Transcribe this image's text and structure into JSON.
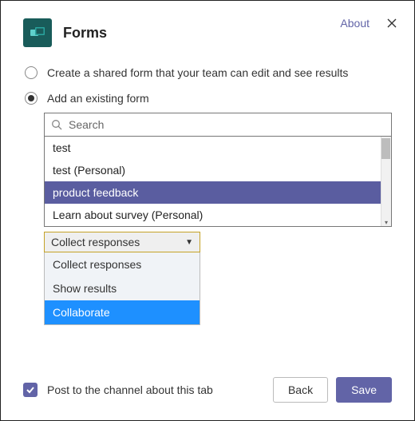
{
  "header": {
    "title": "Forms",
    "about_label": "About"
  },
  "options": {
    "create_label": "Create a shared form that your team can edit and see results",
    "add_existing_label": "Add an existing form",
    "selected": "add_existing"
  },
  "search": {
    "placeholder": "Search",
    "value": "",
    "results": [
      {
        "label": "test",
        "selected": false
      },
      {
        "label": "test (Personal)",
        "selected": false
      },
      {
        "label": "product feedback",
        "selected": true
      },
      {
        "label": "Learn about survey (Personal)",
        "selected": false
      }
    ]
  },
  "mode_select": {
    "value": "Collect responses",
    "options": [
      {
        "label": "Collect responses",
        "highlighted": false
      },
      {
        "label": "Show results",
        "highlighted": false
      },
      {
        "label": "Collaborate",
        "highlighted": true
      }
    ]
  },
  "footer": {
    "post_label": "Post to the channel about this tab",
    "post_checked": true,
    "back_label": "Back",
    "save_label": "Save"
  },
  "colors": {
    "accent": "#6264a7",
    "highlight": "#1e90ff",
    "badge": "#195c5a",
    "select_border": "#c5a227"
  }
}
